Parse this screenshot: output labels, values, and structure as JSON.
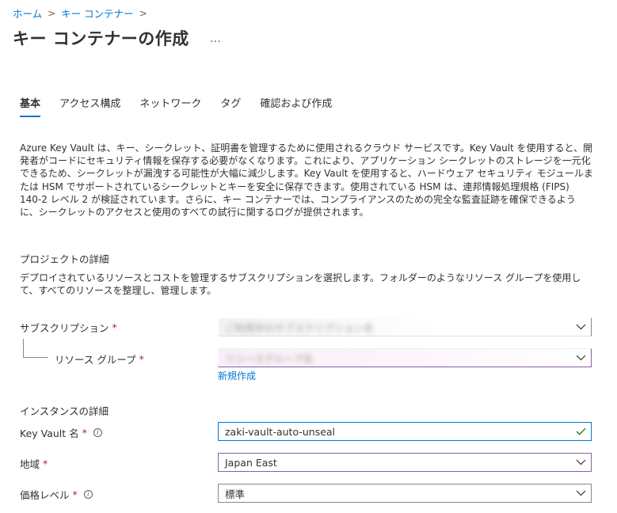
{
  "breadcrumb": {
    "items": [
      "ホーム",
      "キー コンテナー"
    ],
    "separator": ">"
  },
  "page": {
    "title": "キー コンテナーの作成",
    "more_label": "…"
  },
  "tabs": [
    {
      "label": "基本",
      "active": true
    },
    {
      "label": "アクセス構成",
      "active": false
    },
    {
      "label": "ネットワーク",
      "active": false
    },
    {
      "label": "タグ",
      "active": false
    },
    {
      "label": "確認および作成",
      "active": false
    }
  ],
  "description": "Azure Key Vault は、キー、シークレット、証明書を管理するために使用されるクラウド サービスです。Key Vault を使用すると、開発者がコードにセキュリティ情報を保存する必要がなくなります。これにより、アプリケーション シークレットのストレージを一元化できるため、シークレットが漏洩する可能性が大幅に減少します。Key Vault を使用すると、ハードウェア セキュリティ モジュールまたは HSM でサポートされているシークレットとキーを安全に保存できます。使用されている HSM は、連邦情報処理規格 (FIPS) 140-2 レベル 2 が検証されています。さらに、キー コンテナーでは、コンプライアンスのための完全な監査証跡を確保できるように、シークレットのアクセスと使用のすべての試行に関するログが提供されます。",
  "project": {
    "heading": "プロジェクトの詳細",
    "description": "デプロイされているリソースとコストを管理するサブスクリプションを選択します。フォルダーのようなリソース グループを使用して、すべてのリソースを整理し、管理します。",
    "subscription_label": "サブスクリプション",
    "subscription_value": "ご利用中のサブスクリプション名",
    "resource_group_label": "リソース グループ",
    "resource_group_value": "リソースグループ名",
    "new_link": "新規作成"
  },
  "instance": {
    "heading": "インスタンスの詳細",
    "name_label": "Key Vault 名",
    "name_value": "zaki-vault-auto-unseal",
    "region_label": "地域",
    "region_value": "Japan East",
    "tier_label": "価格レベル",
    "tier_value": "標準"
  },
  "required_mark": "*",
  "info_glyph": "i",
  "icons": {
    "chevron": "chevron-down-icon",
    "check": "checkmark-icon",
    "info": "info-icon",
    "more": "ellipsis-icon"
  },
  "colors": {
    "accent": "#0078d4",
    "required": "#a4262c",
    "valid": "#107c10",
    "selected_border": "#8b5ea0"
  }
}
